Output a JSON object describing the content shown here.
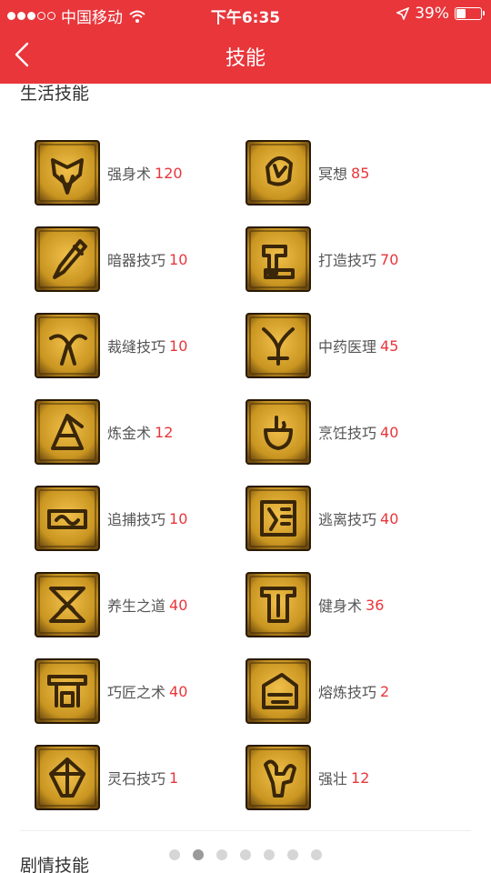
{
  "status_bar": {
    "carrier": "中国移动",
    "time": "下午6:35",
    "battery": "39%",
    "battery_level": 0.39,
    "signal_bars_filled": 3,
    "signal_bars_total": 5
  },
  "nav": {
    "title": "技能"
  },
  "sections": {
    "life": "生活技能",
    "story": "剧情技能"
  },
  "skills": [
    {
      "name": "强身术",
      "level": "120",
      "icon": "strength-icon"
    },
    {
      "name": "冥想",
      "level": "85",
      "icon": "meditation-icon"
    },
    {
      "name": "暗器技巧",
      "level": "10",
      "icon": "dagger-icon"
    },
    {
      "name": "打造技巧",
      "level": "70",
      "icon": "hammer-icon"
    },
    {
      "name": "裁缝技巧",
      "level": "10",
      "icon": "scissors-icon"
    },
    {
      "name": "中药医理",
      "level": "45",
      "icon": "herb-icon"
    },
    {
      "name": "炼金术",
      "level": "12",
      "icon": "alchemy-icon"
    },
    {
      "name": "烹饪技巧",
      "level": "40",
      "icon": "cooking-icon"
    },
    {
      "name": "追捕技巧",
      "level": "10",
      "icon": "chase-icon"
    },
    {
      "name": "逃离技巧",
      "level": "40",
      "icon": "escape-icon"
    },
    {
      "name": "养生之道",
      "level": "40",
      "icon": "health-icon"
    },
    {
      "name": "健身术",
      "level": "36",
      "icon": "fitness-icon"
    },
    {
      "name": "巧匠之术",
      "level": "40",
      "icon": "craftsman-icon"
    },
    {
      "name": "熔炼技巧",
      "level": "2",
      "icon": "smelting-icon"
    },
    {
      "name": "灵石技巧",
      "level": "1",
      "icon": "spirit-stone-icon"
    },
    {
      "name": "强壮",
      "level": "12",
      "icon": "muscle-icon"
    }
  ],
  "pager": {
    "count": 7,
    "active": 1
  },
  "colors": {
    "header": "#e8363b",
    "level": "#e8363b",
    "icon_gold": "#c99520",
    "icon_dark": "#3a2608"
  }
}
